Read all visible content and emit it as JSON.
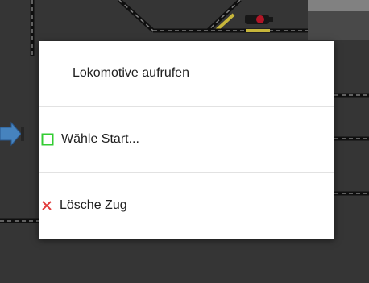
{
  "layout": {
    "background_color": "#3a3a3a"
  },
  "context_menu": {
    "items": [
      {
        "label": "Lokomotive aufrufen",
        "icon": ""
      },
      {
        "label": "Wähle Start...",
        "icon": "start-square-icon",
        "icon_color": "#33cc33"
      },
      {
        "label": "Lösche Zug",
        "icon": "delete-x-icon",
        "icon_color": "#e23a3a"
      }
    ]
  },
  "colors": {
    "track_rail": "#111111",
    "track_dash": "#8a8a8a",
    "signal_yellow": "#d8c640",
    "signal_red": "#c0182a",
    "arrow_blue": "#4d8fcf"
  }
}
